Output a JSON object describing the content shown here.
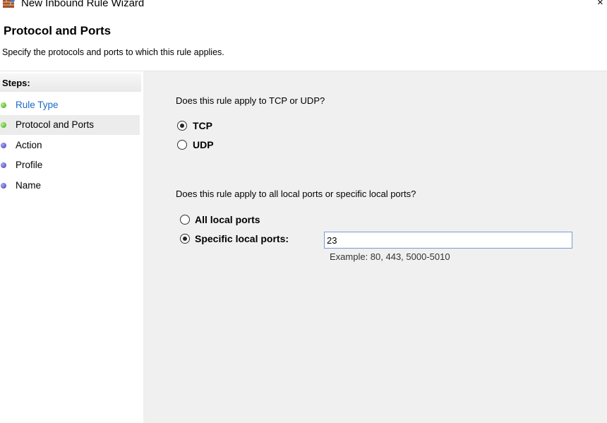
{
  "window": {
    "title": "New Inbound Rule Wizard",
    "close_glyph": "×",
    "app_icon": "firewall-brick-icon"
  },
  "header": {
    "title": "Protocol and Ports",
    "subtitle": "Specify the protocols and ports to which this rule applies."
  },
  "steps": {
    "label": "Steps:",
    "items": [
      {
        "label": "Rule Type",
        "status": "completed",
        "link": true
      },
      {
        "label": "Protocol and Ports",
        "status": "current",
        "link": false
      },
      {
        "label": "Action",
        "status": "pending",
        "link": false
      },
      {
        "label": "Profile",
        "status": "pending",
        "link": false
      },
      {
        "label": "Name",
        "status": "pending",
        "link": false
      }
    ]
  },
  "protocol": {
    "question": "Does this rule apply to TCP or UDP?",
    "options": [
      {
        "label": "TCP",
        "checked": true
      },
      {
        "label": "UDP",
        "checked": false
      }
    ]
  },
  "ports": {
    "question": "Does this rule apply to all local ports or specific local ports?",
    "options": [
      {
        "label": "All local ports",
        "checked": false
      },
      {
        "label": "Specific local ports:",
        "checked": true
      }
    ],
    "value": "23",
    "example": "Example: 80, 443, 5000-5010"
  },
  "colors": {
    "link": "#1b6ac9",
    "content_bg": "#f0f0f0",
    "current_step_bg": "#ececec",
    "completed_dot": "#3aa51c",
    "pending_dot": "#3d3da8"
  }
}
